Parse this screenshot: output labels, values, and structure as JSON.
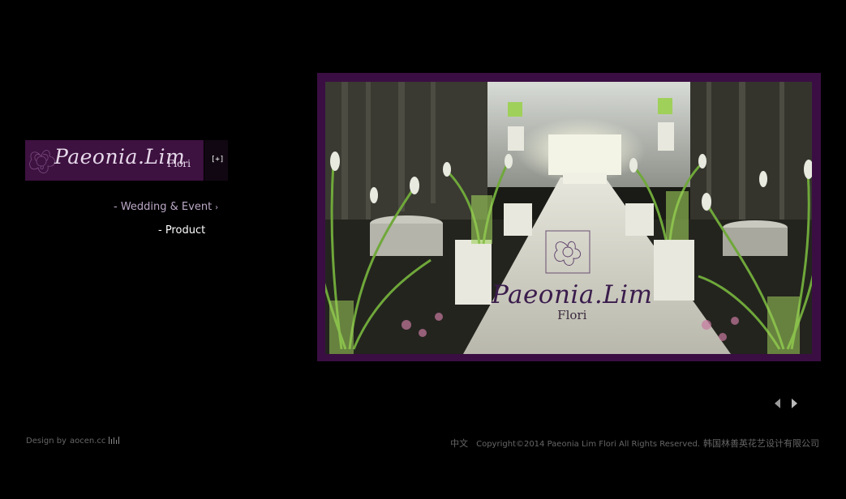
{
  "logo": {
    "script": "Paeonia.Lim",
    "sub": "Flori"
  },
  "expand_button": {
    "label": "[+]"
  },
  "nav": {
    "wedding": "- Wedding & Event",
    "wedding_arrow": "›",
    "product": "- Product"
  },
  "photo": {
    "logo_script": "Paeonia.Lim",
    "logo_sub": "Flori"
  },
  "pager": {
    "prev_icon": "triangle-left-icon",
    "next_icon": "triangle-right-icon"
  },
  "footer": {
    "design_by": "Design by",
    "design_link": "aocen.cc",
    "lang": "中文",
    "copyright": "Copyright©2014 Paeonia Lim Flori  All Rights Reserved.",
    "company": "韩国林善英花艺设计有限公司"
  },
  "colors": {
    "background": "#000000",
    "brand_purple": "#3d1140",
    "frame_purple": "#3a0e43",
    "nav_lilac": "#bba8c6"
  }
}
